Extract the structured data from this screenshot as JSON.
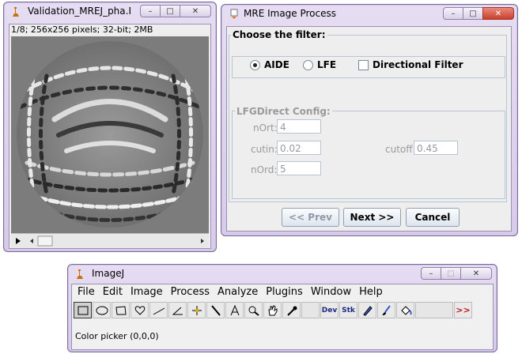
{
  "image_window": {
    "title": "Validation_MREJ_pha.R...",
    "info": "1/8; 256x256 pixels; 32-bit; 2MB",
    "buttons": [
      "–",
      "□",
      "✕"
    ]
  },
  "mre_dialog": {
    "title": "MRE Image Process",
    "filter_group": "Choose the filter:",
    "options": {
      "aide": "AIDE",
      "lfe": "LFE",
      "directional": "Directional Filter"
    },
    "config_group": "LFGDirect Config:",
    "fields": {
      "nort": {
        "label": "nOrt:",
        "value": "4"
      },
      "cutin": {
        "label": "cutin:",
        "value": "0.02"
      },
      "cutoff": {
        "label": "cutoff:",
        "value": "0.45"
      },
      "nord": {
        "label": "nOrd:",
        "value": "5"
      }
    },
    "buttons": {
      "prev": "<< Prev",
      "next": "Next >>",
      "cancel": "Cancel"
    },
    "title_buttons": [
      "–",
      "□",
      "✕"
    ]
  },
  "imagej": {
    "title": "ImageJ",
    "menus": [
      "File",
      "Edit",
      "Image",
      "Process",
      "Analyze",
      "Plugins",
      "Window",
      "Help"
    ],
    "tools": [
      "rectangle-tool",
      "oval-tool",
      "polygon-tool",
      "freehand-tool",
      "line-tool",
      "angle-tool",
      "point-tool",
      "wand-tool",
      "text-tool",
      "magnifier-tool",
      "hand-tool",
      "color-picker-tool",
      "",
      "dev-tool",
      "stk-tool",
      "pencil-tool",
      "brush-tool",
      "flood-fill-tool",
      "",
      "more-tools"
    ],
    "tool_labels": {
      "dev": "Dev",
      "stk": "Stk",
      "more": ">>"
    },
    "status": "Color picker (0,0,0)",
    "title_buttons": [
      "–",
      "□",
      "✕"
    ]
  }
}
